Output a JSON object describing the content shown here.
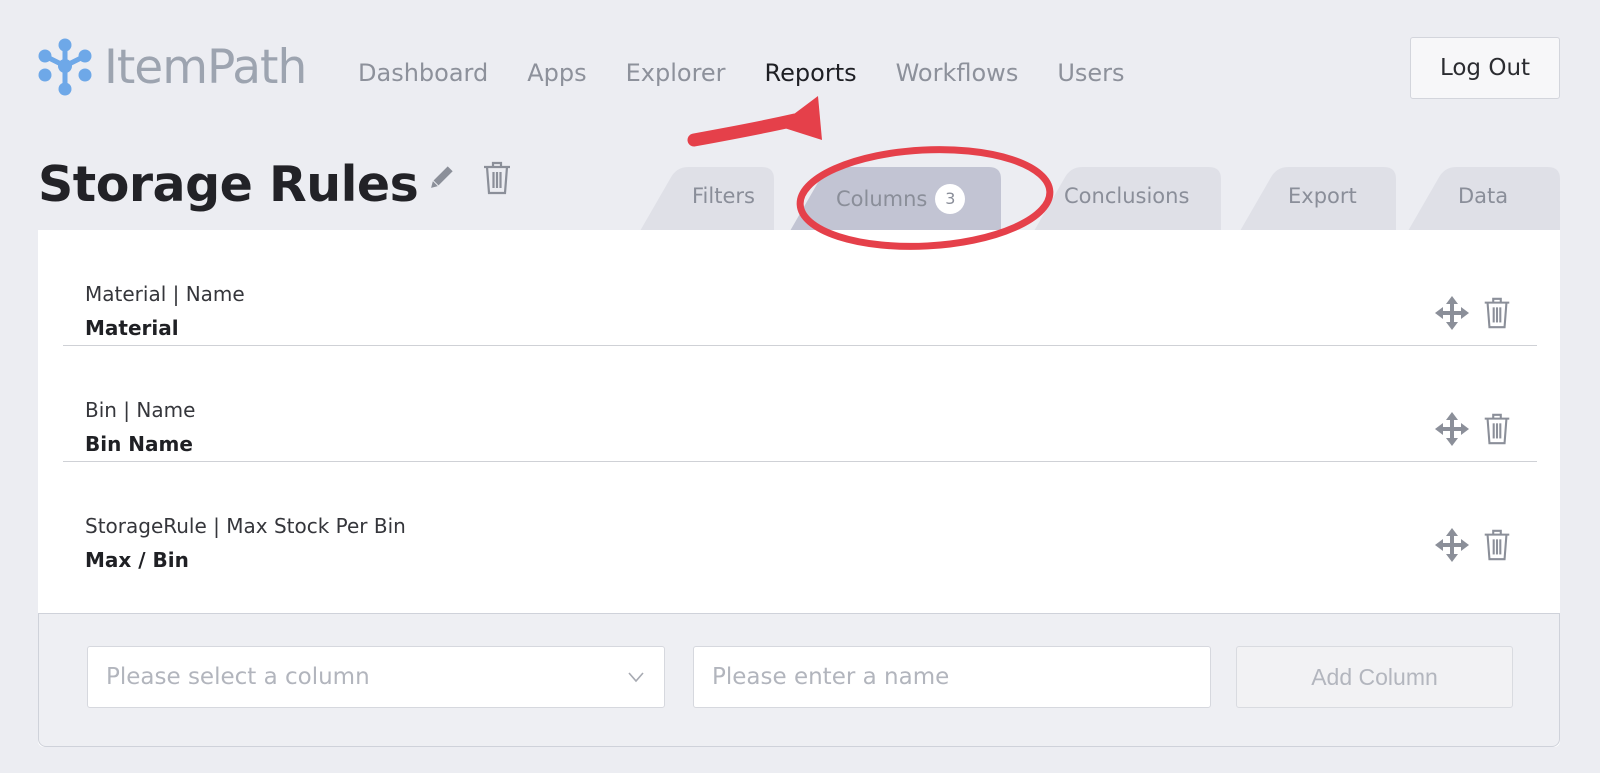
{
  "brand": {
    "name": "ItemPath",
    "logo_icon": "molecule-logo-icon"
  },
  "nav": {
    "items": [
      {
        "label": "Dashboard",
        "active": false
      },
      {
        "label": "Apps",
        "active": false
      },
      {
        "label": "Explorer",
        "active": false
      },
      {
        "label": "Reports",
        "active": true
      },
      {
        "label": "Workflows",
        "active": false
      },
      {
        "label": "Users",
        "active": false
      }
    ],
    "logout_label": "Log Out"
  },
  "page": {
    "title": "Storage Rules",
    "edit_icon": "pencil-icon",
    "delete_icon": "trash-icon"
  },
  "tabs": [
    {
      "label": "Filters",
      "active": false
    },
    {
      "label": "Columns",
      "badge": "3",
      "active": true
    },
    {
      "label": "Conclusions",
      "active": false
    },
    {
      "label": "Export",
      "active": false
    },
    {
      "label": "Data",
      "active": false
    }
  ],
  "columns": [
    {
      "path": "Material | Name",
      "name": "Material"
    },
    {
      "path": "Bin | Name",
      "name": "Bin Name"
    },
    {
      "path": "StorageRule | Max Stock Per Bin",
      "name": "Max / Bin"
    }
  ],
  "add_form": {
    "select_placeholder": "Please select a column",
    "name_placeholder": "Please enter a name",
    "add_label": "Add Column"
  },
  "colors": {
    "accent_logo": "#6ea8e8",
    "annotation_red": "#e5404a",
    "active_tab": "#c2c4d3",
    "inactive_tab": "#dfe0e7"
  }
}
